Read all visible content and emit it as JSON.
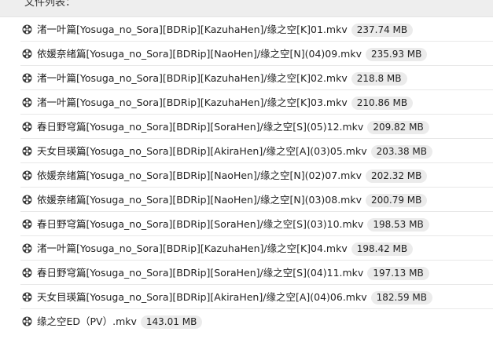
{
  "header": {
    "title": "文件列表："
  },
  "files": [
    {
      "name": "渚一叶篇[Yosuga_no_Sora][BDRip][KazuhaHen]/缘之空[K]01.mkv",
      "size": "237.74 MB",
      "icon": "film-reel-icon"
    },
    {
      "name": "依媛奈绪篇[Yosuga_no_Sora][BDRip][NaoHen]/缘之空[N](04)09.mkv",
      "size": "235.93 MB",
      "icon": "film-reel-icon"
    },
    {
      "name": "渚一叶篇[Yosuga_no_Sora][BDRip][KazuhaHen]/缘之空[K]02.mkv",
      "size": "218.8 MB",
      "icon": "film-reel-icon"
    },
    {
      "name": "渚一叶篇[Yosuga_no_Sora][BDRip][KazuhaHen]/缘之空[K]03.mkv",
      "size": "210.86 MB",
      "icon": "film-reel-icon"
    },
    {
      "name": "春日野穹篇[Yosuga_no_Sora][BDRip][SoraHen]/缘之空[S](05)12.mkv",
      "size": "209.82 MB",
      "icon": "film-reel-icon"
    },
    {
      "name": "天女目瑛篇[Yosuga_no_Sora][BDRip][AkiraHen]/缘之空[A](03)05.mkv",
      "size": "203.38 MB",
      "icon": "film-reel-icon"
    },
    {
      "name": "依媛奈绪篇[Yosuga_no_Sora][BDRip][NaoHen]/缘之空[N](02)07.mkv",
      "size": "202.32 MB",
      "icon": "film-reel-icon"
    },
    {
      "name": "依媛奈绪篇[Yosuga_no_Sora][BDRip][NaoHen]/缘之空[N](03)08.mkv",
      "size": "200.79 MB",
      "icon": "film-reel-icon"
    },
    {
      "name": "春日野穹篇[Yosuga_no_Sora][BDRip][SoraHen]/缘之空[S](03)10.mkv",
      "size": "198.53 MB",
      "icon": "film-reel-icon"
    },
    {
      "name": "渚一叶篇[Yosuga_no_Sora][BDRip][KazuhaHen]/缘之空[K]04.mkv",
      "size": "198.42 MB",
      "icon": "film-reel-icon"
    },
    {
      "name": "春日野穹篇[Yosuga_no_Sora][BDRip][SoraHen]/缘之空[S](04)11.mkv",
      "size": "197.13 MB",
      "icon": "film-reel-icon"
    },
    {
      "name": "天女目瑛篇[Yosuga_no_Sora][BDRip][AkiraHen]/缘之空[A](04)06.mkv",
      "size": "182.59 MB",
      "icon": "film-reel-icon"
    },
    {
      "name": "缘之空ED（PV）.mkv",
      "size": "143.01 MB",
      "icon": "film-reel-icon"
    }
  ],
  "colors": {
    "header_background": "#eeeeee",
    "size_badge_background": "#ebebeb",
    "row_divider": "#e8e8e8",
    "text": "#222222"
  }
}
